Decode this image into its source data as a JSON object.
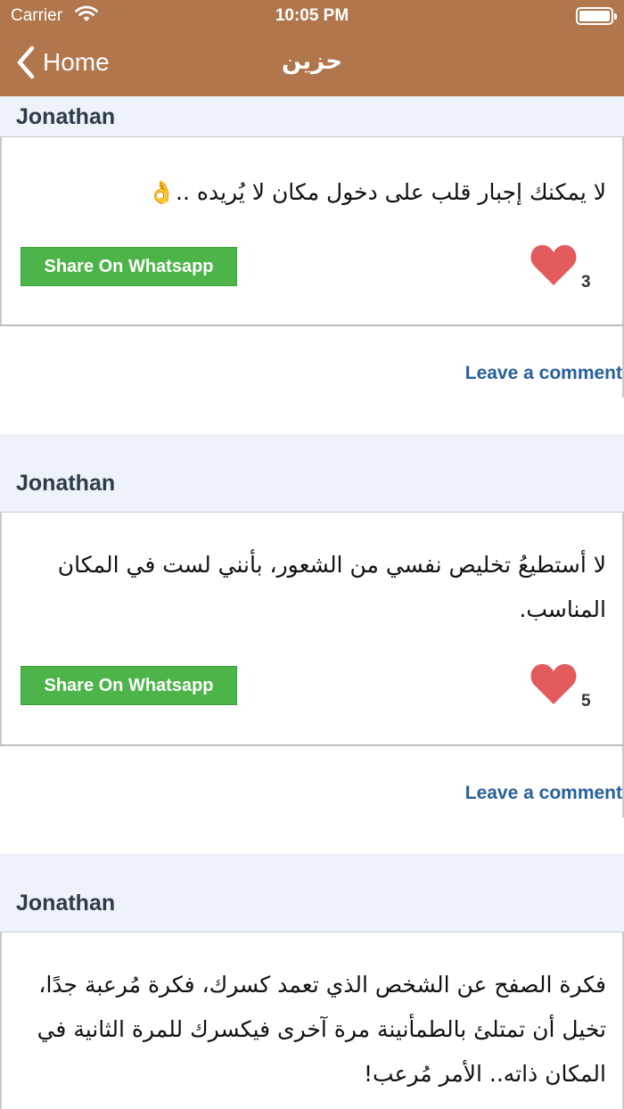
{
  "status_bar": {
    "carrier": "Carrier",
    "time": "10:05 PM"
  },
  "nav": {
    "back_label": "Home",
    "title": "حزين"
  },
  "colors": {
    "header": "#b1764c",
    "share_button": "#4cb449",
    "heart": "#e35b5d",
    "link": "#27609c",
    "author_bar": "#eef2f9"
  },
  "posts": [
    {
      "author": "Jonathan",
      "text": "لا يمكنك إجبار قلب على دخول مكان لا يُريده ..👌",
      "share_label": "Share On Whatsapp",
      "likes": "3",
      "comment_label": "Leave a comment"
    },
    {
      "author": "Jonathan",
      "text": "لا أستطيعُ تخليص نفسي من الشعور، بأنني لست في المكان المناسب.",
      "share_label": "Share On Whatsapp",
      "likes": "5",
      "comment_label": "Leave a comment"
    },
    {
      "author": "Jonathan",
      "text": "فكرة الصفح عن الشخص الذي تعمد كسرك، فكرة مُرعبة جدًا، تخيل أن تمتلئ بالطمأنينة مرة آخرى فيكسرك للمرة الثانية في المكان ذاته.. الأمر مُرعب!"
    }
  ]
}
